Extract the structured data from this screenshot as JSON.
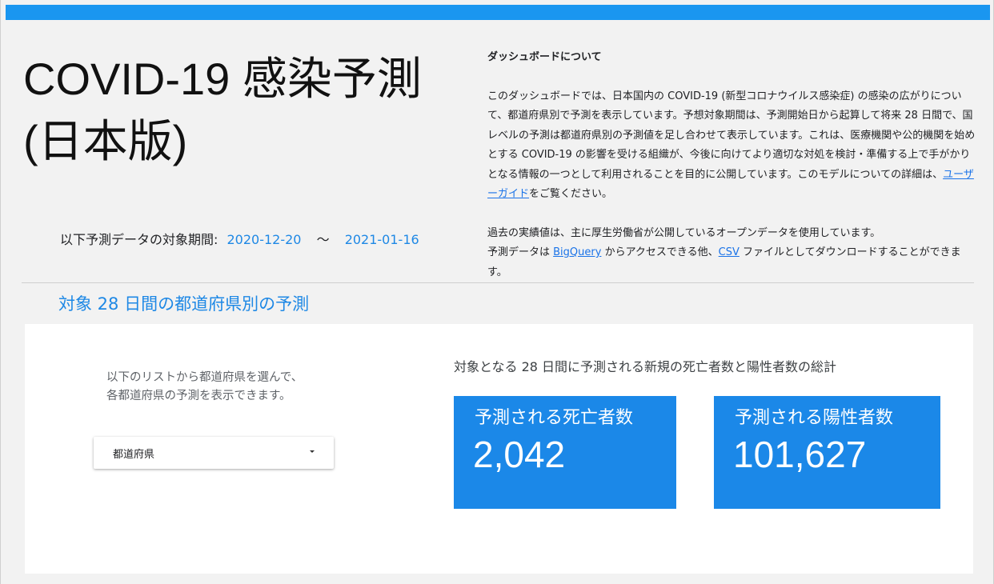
{
  "header": {
    "title_line1": "COVID-19 感染予測",
    "title_line2": "(日本版)",
    "period_label": "以下予測データの対象期間:",
    "period_start": "2020-12-20",
    "period_separator": "〜",
    "period_end": "2021-01-16",
    "accent_color": "#1a96f0"
  },
  "about": {
    "heading": "ダッシュボードについて",
    "paragraph1_before_link": "このダッシュボードでは、日本国内の COVID-19 (新型コロナウイルス感染症) の感染の広がりについて、都道府県別で予測を表示しています。予想対象期間は、予測開始日から起算して将来 28 日間で、国レベルの予測は都道府県別の予測値を足し合わせて表示しています。これは、医療機関や公的機関を始めとする COVID-19 の影響を受ける組織が、今後に向けてより適切な対処を検討・準備する上で手がかりとなる情報の一つとして利用されることを目的に公開しています。このモデルについての詳細は、",
    "user_guide_link": "ユーザーガイド",
    "paragraph1_after_link": "をご覧ください。",
    "paragraph2_line1": "過去の実績値は、主に厚生労働省が公開しているオープンデータを使用しています。",
    "paragraph2_before_bq": "予測データは ",
    "bigquery_link": "BigQuery",
    "paragraph2_between": " からアクセスできる他、",
    "csv_link": "CSV",
    "paragraph2_after_csv": " ファイルとしてダウンロードすることができます。"
  },
  "section": {
    "title": "対象 28 日間の都道府県別の予測"
  },
  "selector": {
    "instructions_line1": "以下のリストから都道府県を選んで、",
    "instructions_line2": "各都道府県の予測を表示できます。",
    "dropdown_value": "都道府県"
  },
  "totals": {
    "heading": "対象となる 28 日間に予測される新規の死亡者数と陽性者数の総計",
    "deaths_label": "予測される死亡者数",
    "deaths_value": "2,042",
    "cases_label": "予測される陽性者数",
    "cases_value": "101,627",
    "card_color": "#1b88e8"
  }
}
